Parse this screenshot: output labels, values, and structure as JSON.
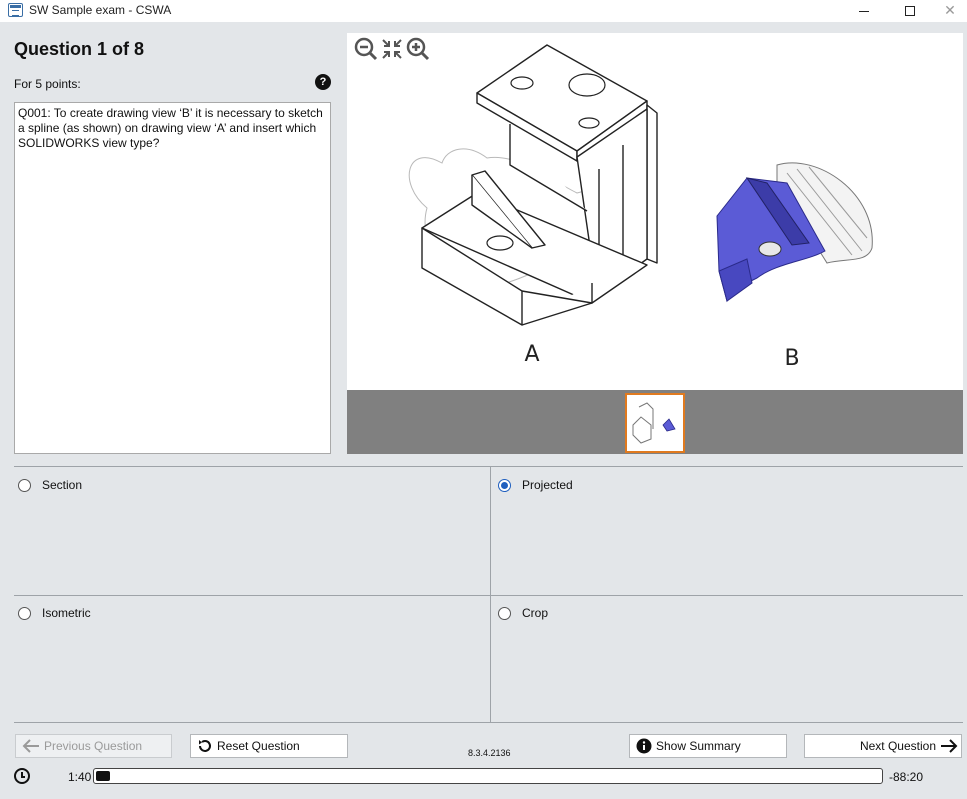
{
  "window": {
    "title": "SW Sample exam - CSWA",
    "icon": "app-window-icon"
  },
  "question": {
    "title": "Question 1 of 8",
    "points": "For 5 points:",
    "text": "Q001: To create drawing view ‘B’ it is necessary to sketch a spline (as shown) on drawing view ‘A’ and insert which SOLIDWORKS view type?"
  },
  "figure": {
    "label_a": "A",
    "label_b": "B",
    "highlight_color": "#5b5bd6",
    "thumbnail_border": "#e07a1f"
  },
  "answers": {
    "options": [
      {
        "label": "Section",
        "selected": false
      },
      {
        "label": "Projected",
        "selected": true
      },
      {
        "label": "Isometric",
        "selected": false
      },
      {
        "label": "Crop",
        "selected": false
      }
    ]
  },
  "nav": {
    "prev_label": "Previous Question",
    "reset_label": "Reset Question",
    "summary_label": "Show Summary",
    "next_label": "Next Question",
    "version": "8.3.4.2136"
  },
  "timer": {
    "elapsed": "1:40",
    "remaining": "-88:20",
    "progress": 0.018
  }
}
